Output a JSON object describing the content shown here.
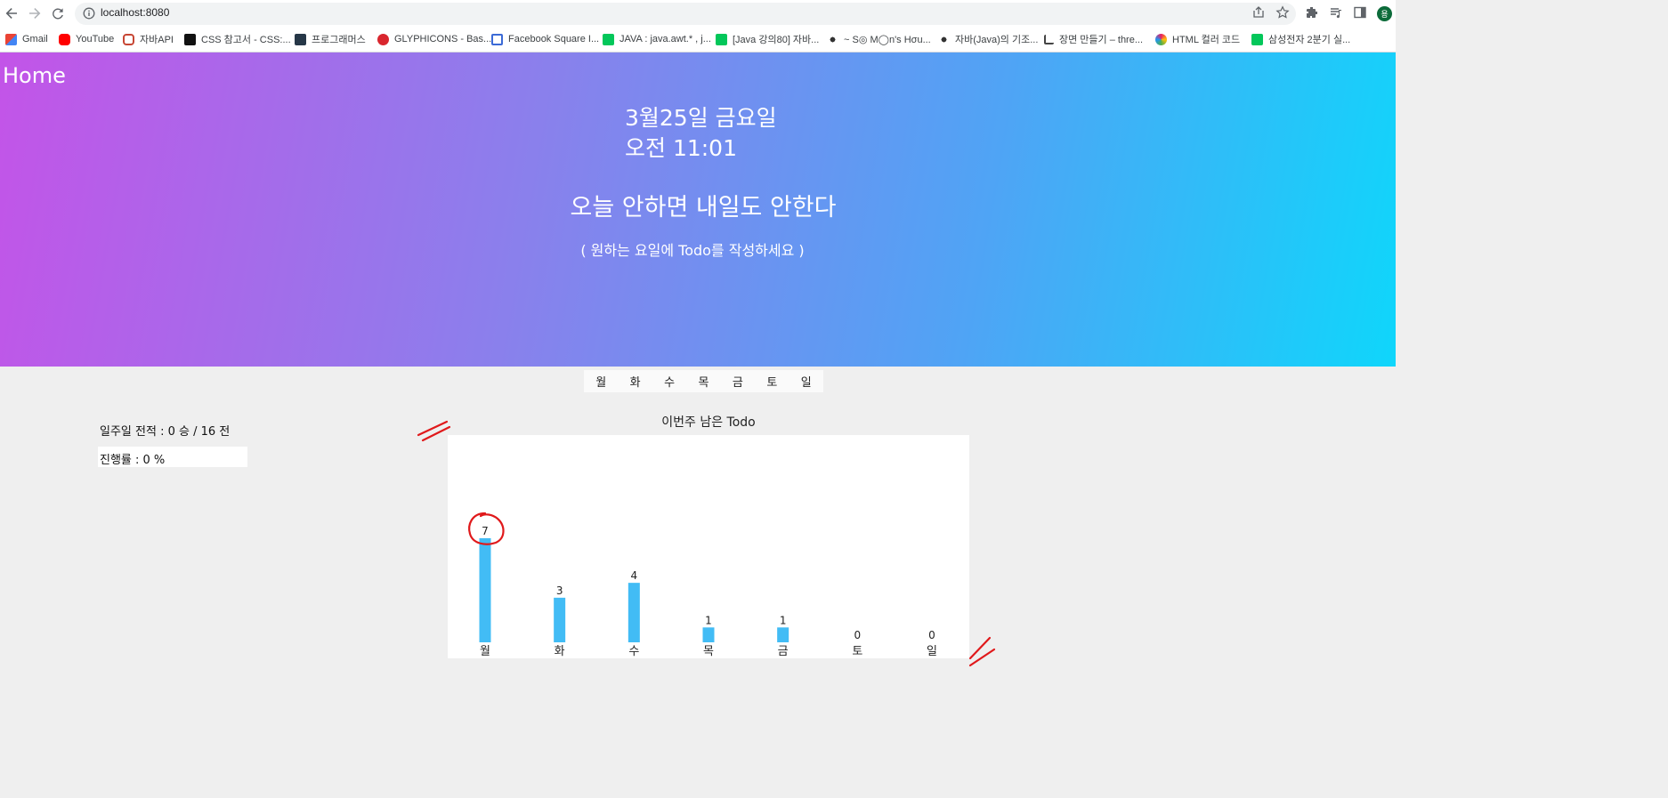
{
  "browser": {
    "url": "localhost:8080",
    "profile_initial": "용",
    "bookmarks": [
      {
        "label": "Gmail",
        "icon": "gmail-icon",
        "color": "#ea4335"
      },
      {
        "label": "YouTube",
        "icon": "youtube-icon",
        "color": "#ff0000"
      },
      {
        "label": "자바API",
        "icon": "oracle-icon",
        "color": "#c74634"
      },
      {
        "label": "CSS 참고서 - CSS:...",
        "icon": "css-icon",
        "color": "#111111"
      },
      {
        "label": "프로그래머스",
        "icon": "programmers-icon",
        "color": "#263747"
      },
      {
        "label": "GLYPHICONS - Bas...",
        "icon": "glyphicons-icon",
        "color": "#d9262e"
      },
      {
        "label": "Facebook Square I...",
        "icon": "flag-icon",
        "color": "#3b6ad6"
      },
      {
        "label": "JAVA : java.awt.* , j...",
        "icon": "naver-blog-icon",
        "color": "#03c75a"
      },
      {
        "label": "[Java 강의80] 자바...",
        "icon": "naver-blog-icon",
        "color": "#03c75a"
      },
      {
        "label": "~ S◎ M◯n's Hσu...",
        "icon": "tistory-icon",
        "color": "#333333"
      },
      {
        "label": "자바(Java)의 기조...",
        "icon": "tistory-icon",
        "color": "#333333"
      },
      {
        "label": "장면 만들기 – thre...",
        "icon": "threejs-icon",
        "color": "#444444"
      },
      {
        "label": "HTML 컬러 코드",
        "icon": "color-wheel-icon",
        "color": "#e91e63"
      },
      {
        "label": "삼성전자 2분기 실...",
        "icon": "naver-blog-icon",
        "color": "#03c75a"
      }
    ]
  },
  "hero": {
    "home_label": "Home",
    "date": "3월25일 금요일",
    "time": "오전 11:01",
    "motto": "오늘 안하면 내일도 안한다",
    "hint": "( 원하는 요일에 Todo를 작성하세요 )"
  },
  "days": [
    "월",
    "화",
    "수",
    "목",
    "금",
    "토",
    "일"
  ],
  "stats": {
    "record": "일주일 전적 : 0 승 / 16 전",
    "progress_label": "진행률 : 0 %",
    "progress_value": 0
  },
  "chart_data": {
    "type": "bar",
    "title": "이번주 남은 Todo",
    "categories": [
      "월",
      "화",
      "수",
      "목",
      "금",
      "토",
      "일"
    ],
    "values": [
      7,
      3,
      4,
      1,
      1,
      0,
      0
    ],
    "ylim": [
      0,
      10
    ],
    "bar_color": "#42bcf5",
    "grid": false
  },
  "annotation_color": "#e0191b"
}
